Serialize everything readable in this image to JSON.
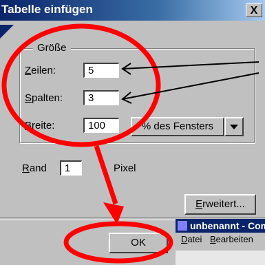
{
  "dialog": {
    "title": "Tabelle einfügen",
    "close_glyph": "X"
  },
  "group": {
    "legend": "Größe",
    "rows_label_accel": "Z",
    "rows_label_rest": "eilen:",
    "rows_value": "5",
    "cols_label_accel": "S",
    "cols_label_rest": "palten:",
    "cols_value": "3",
    "width_label_accel": "B",
    "width_label_rest": "reite:",
    "width_value": "100",
    "width_unit_select": "% des Fensters"
  },
  "border": {
    "label_accel": "R",
    "label_rest": "and",
    "value": "1",
    "unit": "Pixel"
  },
  "buttons": {
    "advanced_accel": "E",
    "advanced_rest": "rweitert...",
    "ok": "OK"
  },
  "background_window": {
    "title": "unbenannt - Comp",
    "menu_item_1_accel": "D",
    "menu_item_1_rest": "atei",
    "menu_item_2_accel": "B",
    "menu_item_2_rest": "earbeiten"
  },
  "colors": {
    "annotation": "#ff0000",
    "titlebar": "#0a246a",
    "dialog_bg": "#c0c0c0"
  }
}
